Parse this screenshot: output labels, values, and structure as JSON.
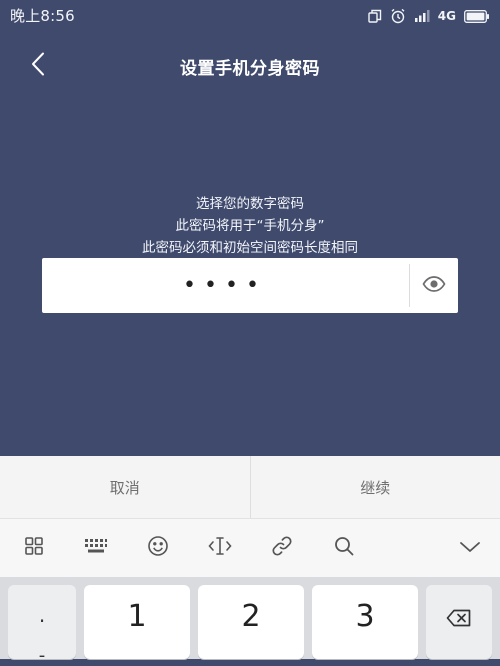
{
  "status_bar": {
    "time": "晚上8:56",
    "network": "4G"
  },
  "header": {
    "title": "设置手机分身密码"
  },
  "instructions": {
    "line1": "选择您的数字密码",
    "line2": "此密码将用于“手机分身”",
    "line3": "此密码必须和初始空间密码长度相同"
  },
  "password": {
    "value": "••••"
  },
  "actions": {
    "cancel_label": "取消",
    "continue_label": "继续"
  },
  "keyboard": {
    "keys": {
      "left_punct": ".",
      "left_punct_2": "-",
      "k1": "1",
      "k2": "2",
      "k3": "3"
    }
  },
  "colors": {
    "background": "#3f4a6d",
    "accent_text": "#ffffff"
  }
}
